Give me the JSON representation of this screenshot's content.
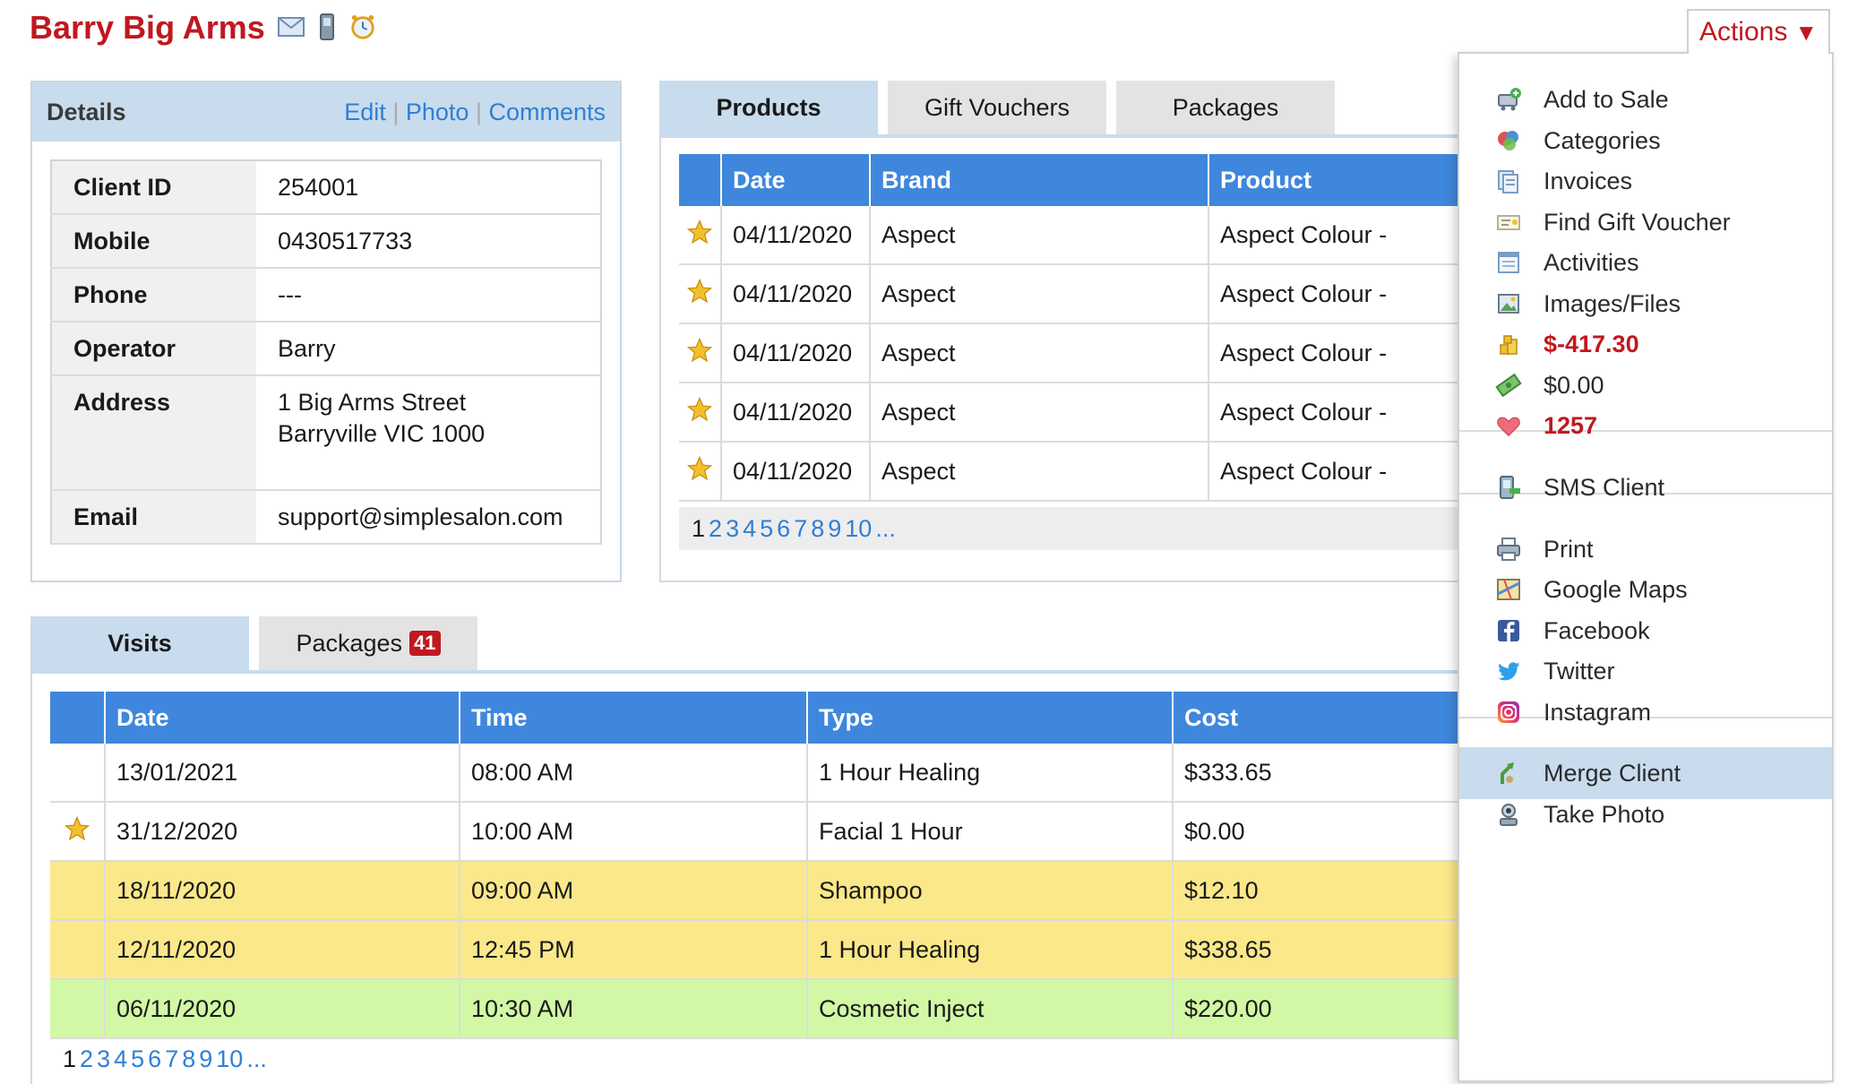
{
  "header": {
    "client_name": "Barry Big Arms",
    "icons": [
      "email-icon",
      "mobile-phone-icon",
      "alarm-clock-icon"
    ],
    "actions_label": "Actions",
    "actions_caret": "▼"
  },
  "details": {
    "title": "Details",
    "links": [
      "Edit",
      "Photo",
      "Comments"
    ],
    "sep": "|",
    "rows": [
      {
        "label": "Client ID",
        "value": "254001"
      },
      {
        "label": "Mobile",
        "value": "0430517733"
      },
      {
        "label": "Phone",
        "value": "---"
      },
      {
        "label": "Operator",
        "value": "Barry"
      },
      {
        "label": "Address",
        "value": "1 Big Arms Street",
        "value2": "Barryville VIC 1000"
      },
      {
        "label": "Email",
        "value": "support@simplesalon.com"
      }
    ]
  },
  "products": {
    "tabs": [
      "Products",
      "Gift Vouchers",
      "Packages"
    ],
    "columns": [
      "Date",
      "Brand",
      "Product"
    ],
    "rows": [
      {
        "starred": true,
        "date": "04/11/2020",
        "brand": "Aspect",
        "product": "Aspect Colour -"
      },
      {
        "starred": true,
        "date": "04/11/2020",
        "brand": "Aspect",
        "product": "Aspect Colour -"
      },
      {
        "starred": true,
        "date": "04/11/2020",
        "brand": "Aspect",
        "product": "Aspect Colour -"
      },
      {
        "starred": true,
        "date": "04/11/2020",
        "brand": "Aspect",
        "product": "Aspect Colour -"
      },
      {
        "starred": true,
        "date": "04/11/2020",
        "brand": "Aspect",
        "product": "Aspect Colour -"
      }
    ],
    "pager": {
      "current": "1",
      "pages": [
        "2",
        "3",
        "4",
        "5",
        "6",
        "7",
        "8",
        "9",
        "10",
        "..."
      ]
    }
  },
  "visits": {
    "tabs": [
      {
        "label": "Visits"
      },
      {
        "label": "Packages",
        "badge": "41"
      }
    ],
    "columns": [
      "Date",
      "Time",
      "Type",
      "Cost"
    ],
    "rows": [
      {
        "starred": false,
        "color": "white",
        "date": "13/01/2021",
        "time": "08:00 AM",
        "type": "1 Hour Healing",
        "cost": "$333.65"
      },
      {
        "starred": true,
        "color": "white",
        "date": "31/12/2020",
        "time": "10:00 AM",
        "type": "Facial 1 Hour",
        "cost": "$0.00"
      },
      {
        "starred": false,
        "color": "yellow",
        "date": "18/11/2020",
        "time": "09:00 AM",
        "type": "Shampoo",
        "cost": "$12.10"
      },
      {
        "starred": false,
        "color": "yellow",
        "date": "12/11/2020",
        "time": "12:45 PM",
        "type": "1 Hour Healing",
        "cost": "$338.65"
      },
      {
        "starred": false,
        "color": "green",
        "date": "06/11/2020",
        "time": "10:30 AM",
        "type": "Cosmetic Inject",
        "cost": "$220.00"
      }
    ],
    "pager": {
      "current": "1",
      "pages": [
        "2",
        "3",
        "4",
        "5",
        "6",
        "7",
        "8",
        "9",
        "10",
        "..."
      ]
    }
  },
  "actions_menu": {
    "items": [
      {
        "label": "Add to Sale",
        "icon": "cart-add-icon"
      },
      {
        "label": "Categories",
        "icon": "categories-icon"
      },
      {
        "label": "Invoices",
        "icon": "invoices-icon"
      },
      {
        "label": "Find Gift Voucher",
        "icon": "gift-voucher-icon"
      },
      {
        "label": "Activities",
        "icon": "activities-icon"
      },
      {
        "label": "Images/Files",
        "icon": "images-icon"
      },
      {
        "label": "$-417.30",
        "icon": "coins-icon",
        "style": "red"
      },
      {
        "label": "$0.00",
        "icon": "cash-icon"
      },
      {
        "label": "1257",
        "icon": "heart-icon",
        "style": "red"
      },
      {
        "label": "SMS Client",
        "icon": "sms-icon"
      },
      {
        "label": "Print",
        "icon": "printer-icon"
      },
      {
        "label": "Google Maps",
        "icon": "map-icon"
      },
      {
        "label": "Facebook",
        "icon": "facebook-icon"
      },
      {
        "label": "Twitter",
        "icon": "twitter-icon"
      },
      {
        "label": "Instagram",
        "icon": "instagram-icon"
      },
      {
        "label": "Merge Client",
        "icon": "merge-icon",
        "highlighted": true
      },
      {
        "label": "Take Photo",
        "icon": "camera-icon"
      }
    ]
  },
  "colors": {
    "brand_red": "#c0181f",
    "header_blue": "#3f87dc",
    "panel_blue": "#c8dced",
    "link_blue": "#2f7fd6",
    "row_yellow": "#fbe88a",
    "row_green": "#d2f8a6"
  }
}
